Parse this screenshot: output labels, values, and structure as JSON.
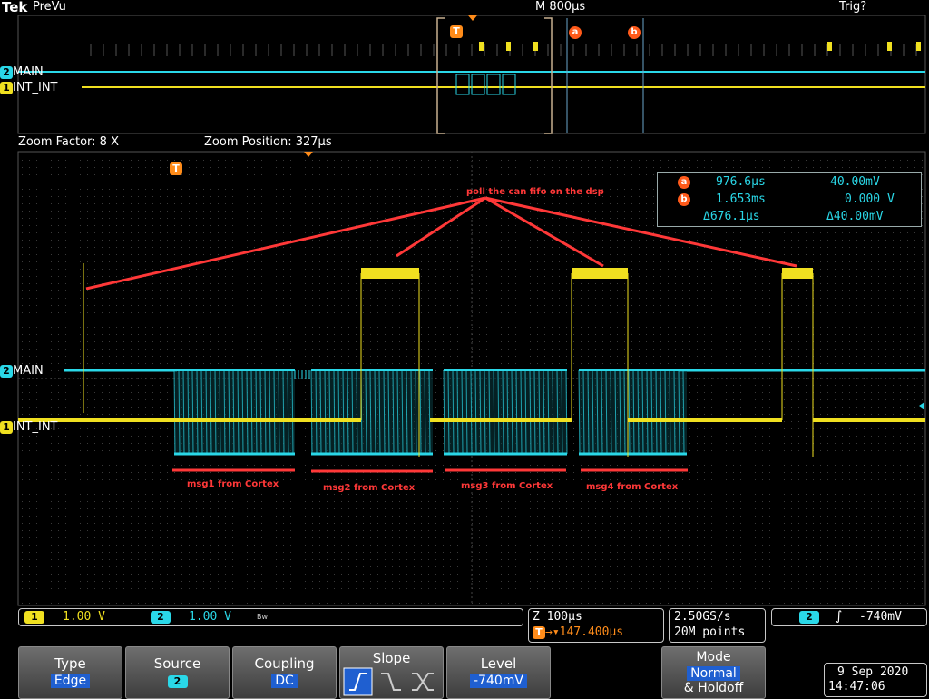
{
  "header": {
    "brand": "Tek",
    "mode": "PreVu",
    "horizontal_scale": "M 800µs",
    "trigger_status": "Trig?"
  },
  "markers": {
    "trigger": "T",
    "cursor_a": "a",
    "cursor_b": "b"
  },
  "channels": {
    "ch1": {
      "num": "1",
      "label": "INT_INT",
      "color": "#f0e020"
    },
    "ch2": {
      "num": "2",
      "label": "MAIN",
      "color": "#2ad8e8"
    }
  },
  "zoom": {
    "factor": "Zoom Factor: 8 X",
    "position": "Zoom Position: 327µs"
  },
  "cursors": {
    "a_time": "976.6µs",
    "a_volt": "40.00mV",
    "b_time": "1.653ms",
    "b_volt": "0.000 V",
    "delta_time": "Δ676.1µs",
    "delta_volt": "Δ40.00mV"
  },
  "annotations": {
    "dsp_poll": "poll the can fifo on the dsp",
    "msg1": "msg1 from Cortex",
    "msg2": "msg2 from Cortex",
    "msg3": "msg3 from Cortex",
    "msg4": "msg4 from Cortex"
  },
  "status": {
    "ch1_scale": "1.00 V",
    "ch2_scale": "1.00 V",
    "bw_symbol": "Bw",
    "zoom_scale": "Z 100µs",
    "trigger_pos": "→▾147.400µs",
    "sample_rate": "2.50GS/s",
    "record_length": "20M points",
    "trigger_slope_symbol": "∫",
    "trigger_level": "-740mV"
  },
  "menu": {
    "type": {
      "title": "Type",
      "value": "Edge"
    },
    "source": {
      "title": "Source",
      "value": "2"
    },
    "coupling": {
      "title": "Coupling",
      "value": "DC"
    },
    "slope": {
      "title": "Slope"
    },
    "level": {
      "title": "Level",
      "value": "-740mV"
    },
    "mode": {
      "title": "Mode",
      "value": "Normal",
      "suffix": "& Holdoff"
    }
  },
  "datetime": {
    "date": "9 Sep  2020",
    "time": "14:47:06"
  },
  "colors": {
    "cyan": "#2ad8e8",
    "yellow": "#f0e020",
    "annot_red": "#ff3838",
    "cursor_orange": "#ff5a1a",
    "menu_value_bg": "#1f5fd0"
  }
}
